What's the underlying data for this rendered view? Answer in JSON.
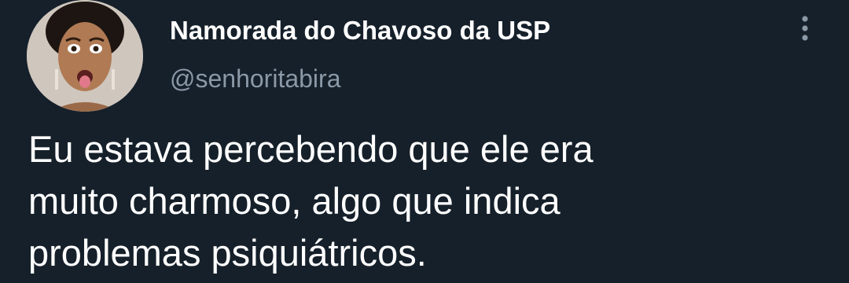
{
  "author": {
    "display_name": "Namorada do Chavoso da USP",
    "handle": "@senhoritabira",
    "avatar_icon": "profile-photo"
  },
  "menu": {
    "more_icon": "more-vertical-icon"
  },
  "tweet": {
    "lines": [
      "Eu estava percebendo que ele era",
      "muito charmoso, algo que indica",
      "problemas psiquiátricos."
    ]
  },
  "colors": {
    "background": "#15202b",
    "name": "#ffffff",
    "handle": "#8b98a5",
    "text": "#ffffff",
    "icon": "#8b98a5"
  }
}
